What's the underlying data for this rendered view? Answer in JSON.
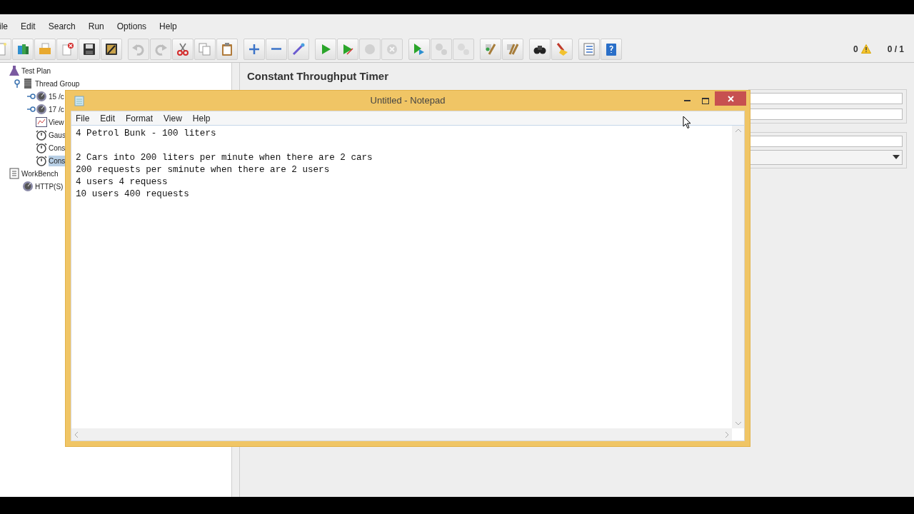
{
  "menu_bar": [
    "ile",
    "Edit",
    "Search",
    "Run",
    "Options",
    "Help"
  ],
  "toolbar": [
    {
      "kind": "new",
      "disabled": false
    },
    {
      "kind": "templates",
      "disabled": false
    },
    {
      "kind": "open",
      "disabled": false
    },
    {
      "kind": "close",
      "disabled": false
    },
    {
      "kind": "save",
      "disabled": false
    },
    {
      "kind": "save_as",
      "disabled": false
    },
    {
      "kind": "sep"
    },
    {
      "kind": "undo",
      "disabled": true
    },
    {
      "kind": "redo",
      "disabled": true
    },
    {
      "kind": "cut",
      "disabled": false
    },
    {
      "kind": "copy",
      "disabled": false
    },
    {
      "kind": "paste",
      "disabled": false
    },
    {
      "kind": "sep"
    },
    {
      "kind": "add",
      "disabled": false
    },
    {
      "kind": "remove",
      "disabled": false
    },
    {
      "kind": "toggle",
      "disabled": false
    },
    {
      "kind": "sep"
    },
    {
      "kind": "start",
      "disabled": false
    },
    {
      "kind": "start_no_pause",
      "disabled": false
    },
    {
      "kind": "stop",
      "disabled": true
    },
    {
      "kind": "shutdown",
      "disabled": true
    },
    {
      "kind": "sep"
    },
    {
      "kind": "remote_start",
      "disabled": false
    },
    {
      "kind": "remote_stop",
      "disabled": true
    },
    {
      "kind": "remote_exit",
      "disabled": true
    },
    {
      "kind": "sep"
    },
    {
      "kind": "clear",
      "disabled": false
    },
    {
      "kind": "clear_all",
      "disabled": false
    },
    {
      "kind": "sep"
    },
    {
      "kind": "search",
      "disabled": false
    },
    {
      "kind": "reset_search",
      "disabled": false
    },
    {
      "kind": "sep"
    },
    {
      "kind": "function_helper",
      "disabled": false
    },
    {
      "kind": "help",
      "disabled": false
    }
  ],
  "status": {
    "warnings": "0",
    "threads": "0 / 1"
  },
  "tree": [
    {
      "label": "Test Plan",
      "kind": "plan",
      "selected": false,
      "children": [
        {
          "label": "Thread Group",
          "kind": "threads",
          "selected": false,
          "expanded": true,
          "children": [
            {
              "label": "15 /c",
              "kind": "sampler",
              "selected": false,
              "expanded": false
            },
            {
              "label": "17 /c",
              "kind": "sampler",
              "selected": false,
              "expanded": false
            },
            {
              "label": "View",
              "kind": "listener",
              "selected": false
            },
            {
              "label": "Gaus",
              "kind": "timer",
              "selected": false
            },
            {
              "label": "Cons",
              "kind": "timer",
              "selected": false
            },
            {
              "label": "Cons",
              "kind": "timer",
              "selected": true
            }
          ]
        }
      ]
    },
    {
      "label": "WorkBench",
      "kind": "workbench",
      "selected": false,
      "children": [
        {
          "label": "HTTP(S)",
          "kind": "sampler",
          "selected": false
        }
      ]
    }
  ],
  "panel": {
    "title": "Constant Throughput Timer"
  },
  "notepad": {
    "title": "Untitled - Notepad",
    "menu": [
      "File",
      "Edit",
      "Format",
      "View",
      "Help"
    ],
    "text": "4 Petrol Bunk - 100 liters\n\n2 Cars into 200 liters per minute when there are 2 cars\n200 requests per sminute when there are 2 users\n4 users 4 requess\n10 users 400 requests"
  }
}
